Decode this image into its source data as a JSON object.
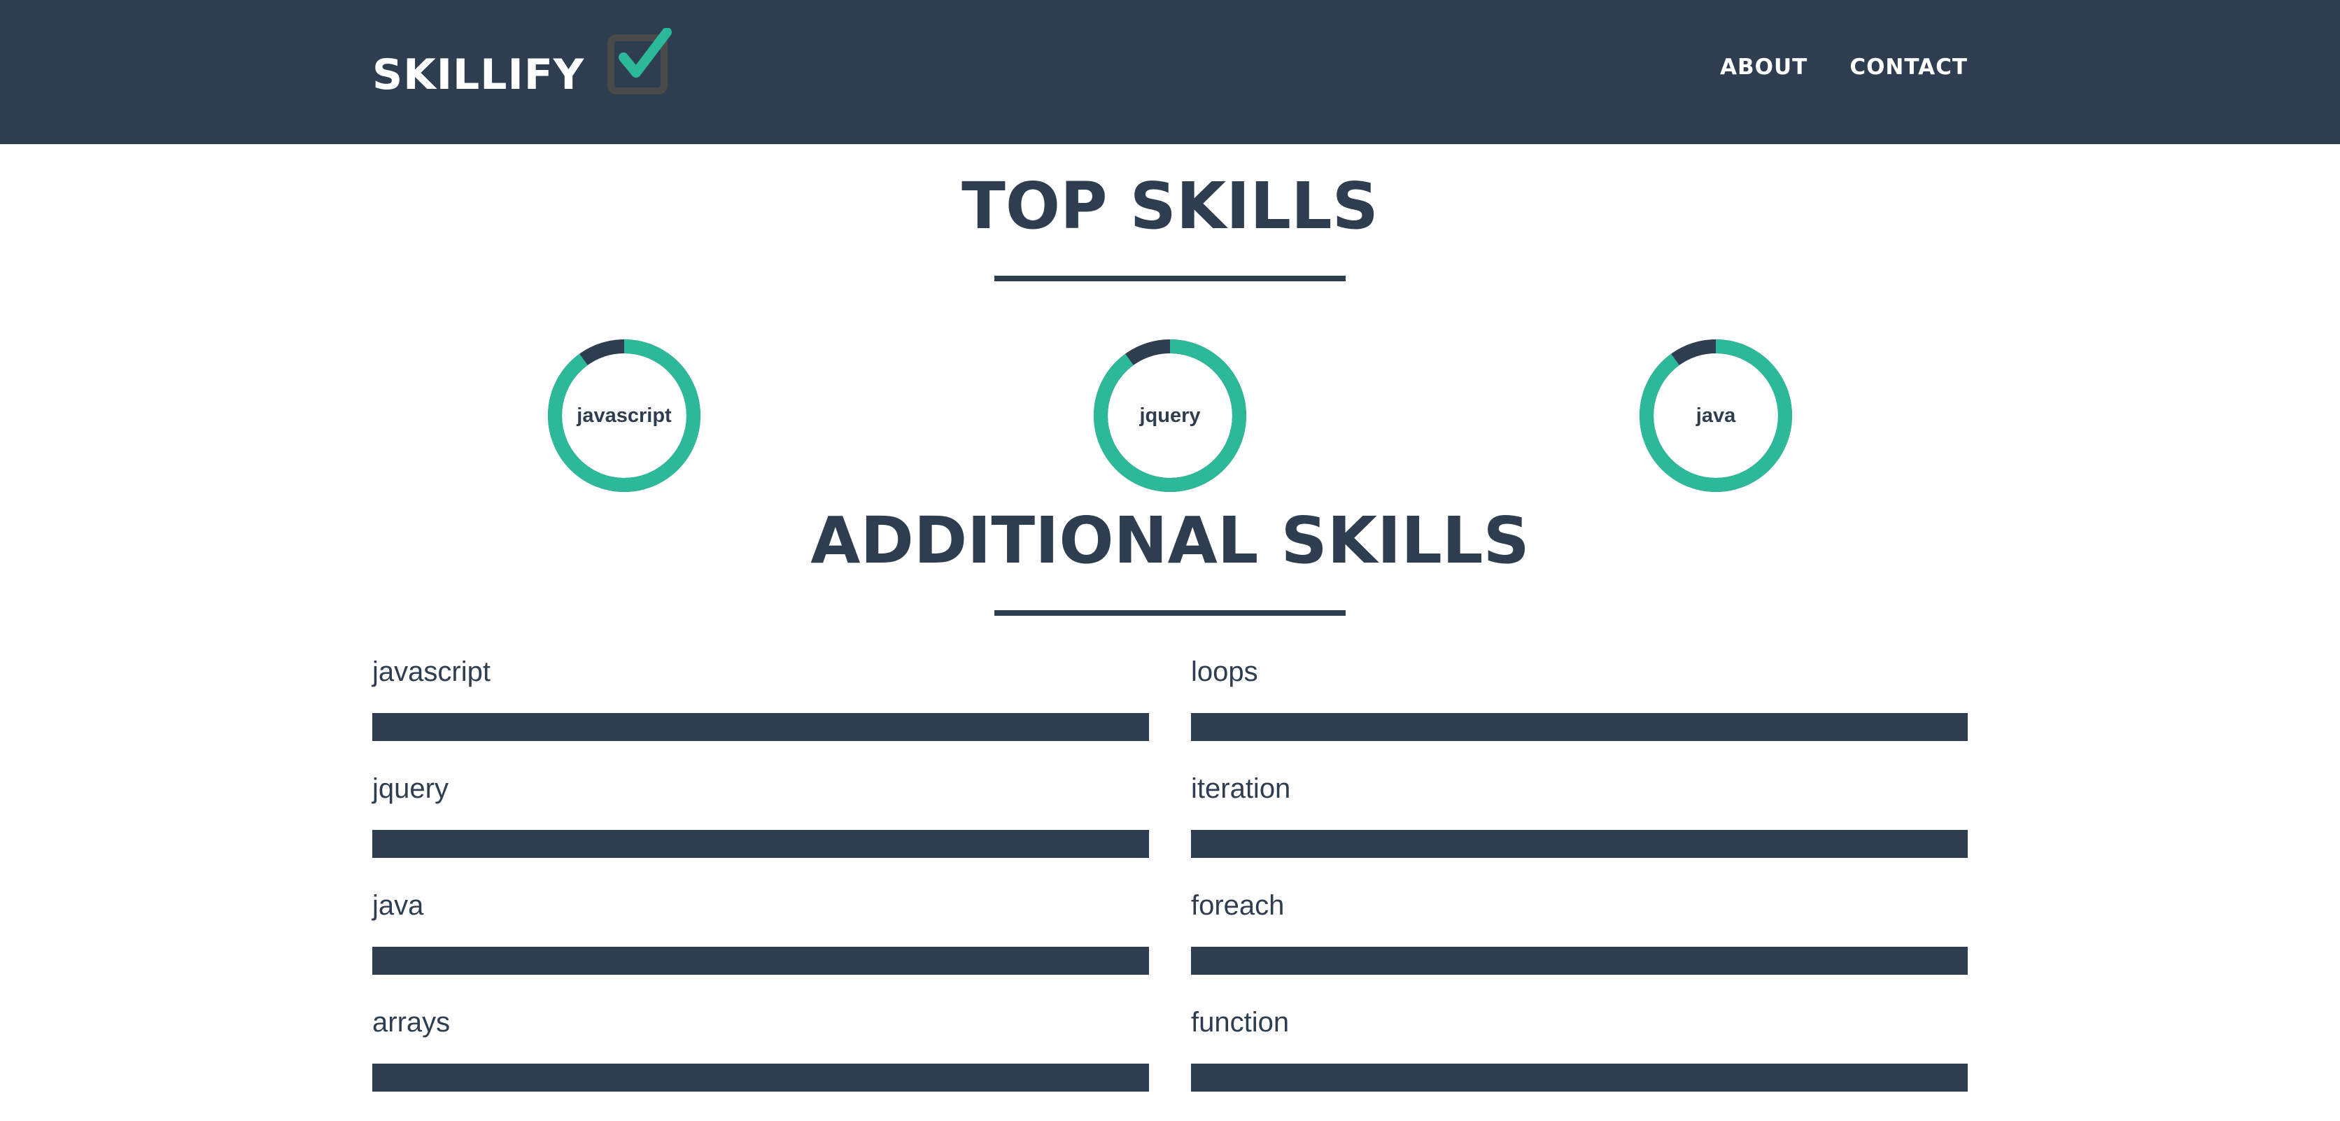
{
  "brand": {
    "name": "SKILLIFY",
    "icon": "check-box-icon",
    "icon_colors": {
      "box": "#4a4a4a",
      "check": "#2bb99a"
    }
  },
  "nav": {
    "links": [
      {
        "label": "ABOUT"
      },
      {
        "label": "CONTACT"
      }
    ]
  },
  "colors": {
    "primary": "#2e3d4f",
    "accent": "#2bb99a",
    "background": "#ffffff"
  },
  "top_skills": {
    "title": "TOP SKILLS",
    "items": [
      {
        "label": "javascript",
        "level": 0.9
      },
      {
        "label": "jquery",
        "level": 0.9
      },
      {
        "label": "java",
        "level": 0.9
      }
    ]
  },
  "additional_skills": {
    "title": "ADDITIONAL SKILLS",
    "items": [
      {
        "label": "javascript",
        "level": 1.0
      },
      {
        "label": "loops",
        "level": 1.0
      },
      {
        "label": "jquery",
        "level": 1.0
      },
      {
        "label": "iteration",
        "level": 1.0
      },
      {
        "label": "java",
        "level": 1.0
      },
      {
        "label": "foreach",
        "level": 1.0
      },
      {
        "label": "arrays",
        "level": 1.0
      },
      {
        "label": "function",
        "level": 1.0
      }
    ]
  }
}
